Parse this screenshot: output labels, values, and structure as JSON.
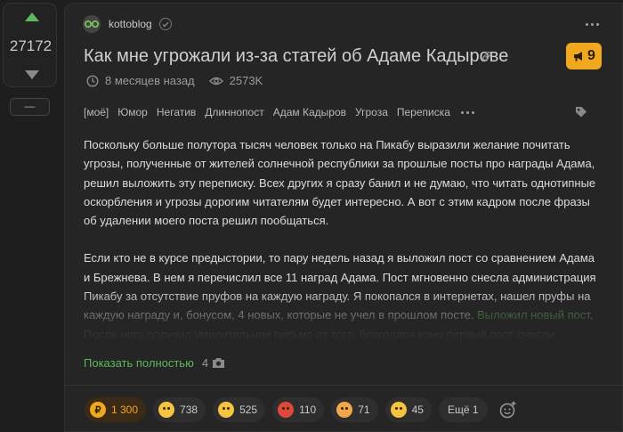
{
  "vote": {
    "count": "27172",
    "collapse_label": "—"
  },
  "post": {
    "author": "kottoblog",
    "title": "Как мне угрожали из-за статей об Адаме Кадырове",
    "rating_badge": "9",
    "meta": {
      "time": "8 месяцев назад",
      "views": "2573K"
    },
    "tags": [
      "[моё]",
      "Юмор",
      "Негатив",
      "Длиннопост",
      "Адам Кадыров",
      "Угроза",
      "Переписка"
    ],
    "body": {
      "p1": "Поскольку больше полутора тысяч человек только на Пикабу выразили желание почитать угрозы, полученные от жителей солнечной республики за прошлые посты про награды Адама, решил выложить эту переписку. Всех других я сразу банил и не думаю, что читать однотипные оскорбления и угрозы дорогим читателям будет интересно. А вот с этим кадром после фразы об удалении моего поста решил пообщаться.",
      "p2_text": "Если кто не в курсе предыстории, то пару недель назад я выложил пост со сравнением Адама и Брежнева. В нем я перечислил все 11 наград Адама. Пост мгновенно снесла администрация Пикабу за отсутствие пруфов на каждую награду. Я покопался в интернетах, нашел пруфы на каждую награду и, бонусом, 4 новых, которые не учел в прошлом посте. ",
      "p2_link": "Выложил новый пост",
      "p2_after": ". После него получил умилительное письмо от того, благодаря кому первый пост снесли."
    },
    "show_more": "Показать полностью",
    "photo_count": "4"
  },
  "reactions": [
    {
      "icon": "pikabu-coin-icon",
      "count": "1 300"
    },
    {
      "icon": "grin-emoji-icon",
      "count": "738"
    },
    {
      "icon": "smile-emoji-icon",
      "count": "525"
    },
    {
      "icon": "angry-emoji-icon",
      "count": "110"
    },
    {
      "icon": "shocked-emoji-icon",
      "count": "71"
    },
    {
      "icon": "sad-emoji-icon",
      "count": "45"
    }
  ],
  "reactions_more": "Ещё 1",
  "colors": {
    "accent_green": "#5db85c",
    "badge_orange": "#f0a81e",
    "background": "#1e1e1e",
    "card": "#252525"
  }
}
